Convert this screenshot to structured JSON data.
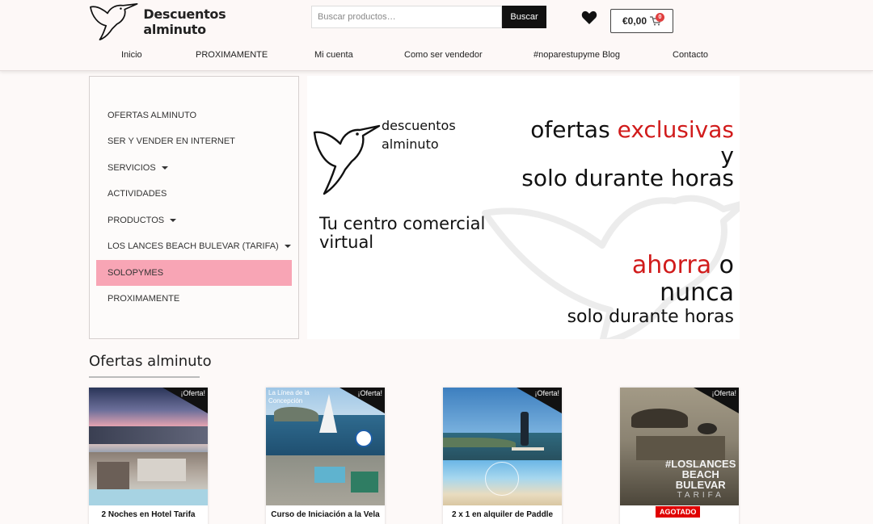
{
  "header": {
    "brand": "Descuentos alminuto",
    "search_placeholder": "Buscar productos…",
    "search_button": "Buscar",
    "cart_amount": "€0,00",
    "cart_count": "0"
  },
  "nav": [
    "Inicio",
    "PROXIMAMENTE",
    "Mi cuenta",
    "Como ser vendedor",
    "#noparestupyme Blog",
    "Contacto"
  ],
  "sidebar": {
    "items": [
      {
        "label": "OFERTAS ALMINUTO",
        "has_submenu": false
      },
      {
        "label": "SER Y VENDER EN INTERNET",
        "has_submenu": false
      },
      {
        "label": "SERVICIOS",
        "has_submenu": true
      },
      {
        "label": "ACTIVIDADES",
        "has_submenu": false
      },
      {
        "label": "PRODUCTOS",
        "has_submenu": true
      },
      {
        "label": "LOS LANCES BEACH BULEVAR (TARIFA)",
        "has_submenu": true
      },
      {
        "label": "SOLOPYMES",
        "has_submenu": false,
        "active": true
      },
      {
        "label": "PROXIMAMENTE",
        "has_submenu": false
      }
    ]
  },
  "banner": {
    "logo_line1": "descuentos",
    "logo_line2": "alminuto",
    "ofertas": "ofertas",
    "exclusivas": "exclusivas",
    "y": "y",
    "solo_horas_1": "solo durante horas",
    "tagline_1": "Tu centro comercial",
    "tagline_2": "virtual",
    "ahorra": "ahorra",
    "o": "o",
    "nunca": "nunca",
    "solo_horas_2": "solo durante horas",
    "accent_color": "#d11b1b"
  },
  "section": {
    "title": "Ofertas alminuto"
  },
  "products": [
    {
      "title": "2 Noches en Hotel Tarifa",
      "badge": "¡Oferta!",
      "sold_out": false
    },
    {
      "title": "Curso de Iniciación a la Vela",
      "badge": "¡Oferta!",
      "sold_out": false,
      "overlay_1": "La Línea de la",
      "overlay_2": "Concepción"
    },
    {
      "title": "2 x 1 en alquiler de Paddle",
      "badge": "¡Oferta!",
      "sold_out": false
    },
    {
      "title": "",
      "badge": "¡Oferta!",
      "sold_out": true,
      "sold_label": "AGOTADO",
      "overlay_1": "#LOSLANCES",
      "overlay_2": "BEACH",
      "overlay_3": "BULEVAR",
      "overlay_4": "TARIFA"
    }
  ]
}
